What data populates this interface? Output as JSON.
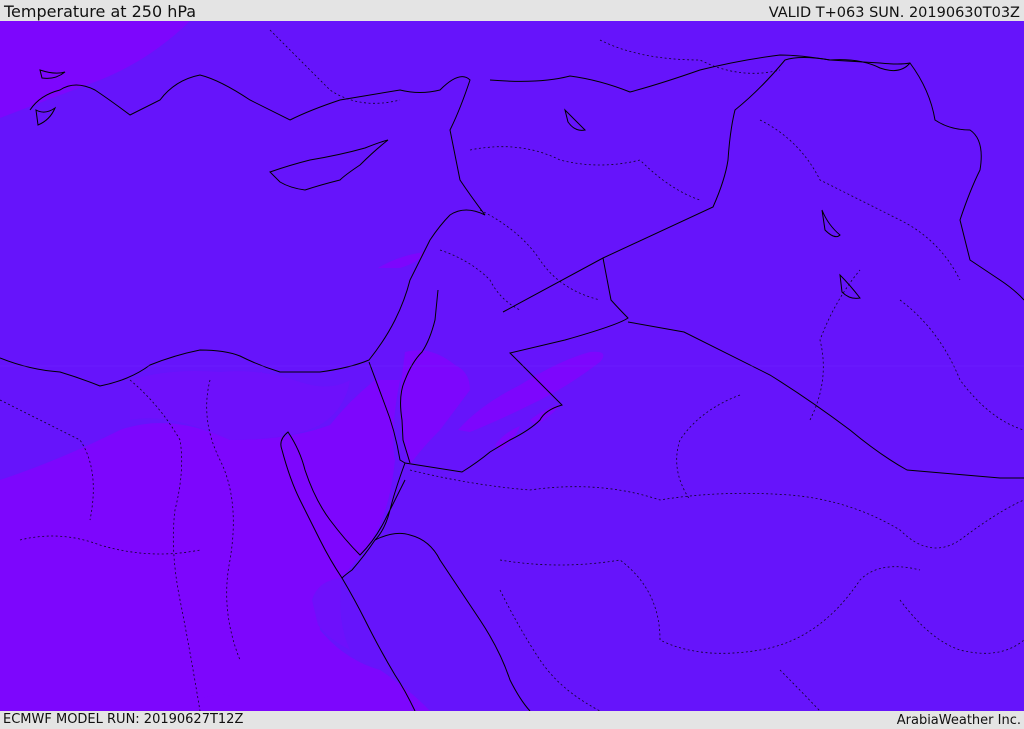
{
  "header": {
    "title": "Temperature at 250 hPa",
    "valid_time": "VALID T+063 SUN. 20190630T03Z"
  },
  "footer": {
    "model_run": "ECMWF MODEL RUN: 20190627T12Z",
    "credit": "ArabiaWeather Inc."
  },
  "map": {
    "variable": "temperature",
    "level": "250 hPa",
    "colors": {
      "dominant_field": "#6614fb",
      "warm_field": "#7d06fd",
      "intermediate_field": "#6e10fb",
      "boundaries": "#000000"
    }
  }
}
